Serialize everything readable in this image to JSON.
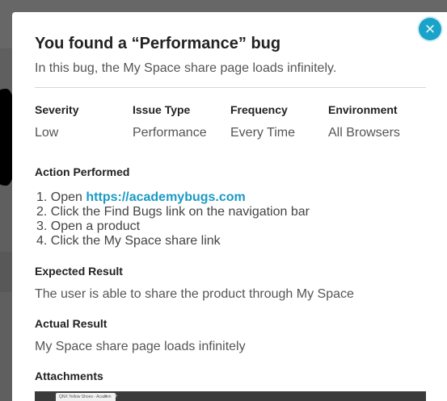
{
  "modal": {
    "close_icon": "×",
    "title": "You found a “Performance” bug",
    "subtitle": "In this bug, the My Space share page loads infinitely."
  },
  "meta": [
    {
      "label": "Severity",
      "value": "Low"
    },
    {
      "label": "Issue Type",
      "value": "Performance"
    },
    {
      "label": "Frequency",
      "value": "Every Time"
    },
    {
      "label": "Environment",
      "value": "All Browsers"
    }
  ],
  "action": {
    "title": "Action Performed",
    "steps": [
      {
        "num": "1.",
        "prefix": "Open ",
        "link": "https://academybugs.com"
      },
      {
        "num": "2.",
        "text": "Click the Find Bugs link on the navigation bar"
      },
      {
        "num": "3.",
        "text": "Open a product"
      },
      {
        "num": "4.",
        "text": "Click the My Space share link"
      }
    ]
  },
  "expected": {
    "title": "Expected Result",
    "text": "The user is able to share the product through My Space"
  },
  "actual": {
    "title": "Actual Result",
    "text": "My Space share page loads infinitely"
  },
  "attachments": {
    "title": "Attachments",
    "tab_label": "QNX Yellow Shoes - Academ",
    "tab_close": "×",
    "new_tab": "+",
    "colors": {
      "accent": "#1aa3c9",
      "link": "#1a9ac4",
      "dot_red": "#e0443e",
      "dot_yellow": "#dea123",
      "dot_green": "#1aab29"
    }
  }
}
